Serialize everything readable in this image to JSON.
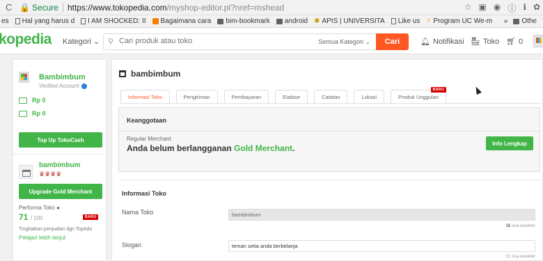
{
  "browser": {
    "secure_label": "Secure",
    "url_host": "https://www.tokopedia.com",
    "url_path": "/myshop-editor.pl?nref=mshead",
    "bookmarks": [
      {
        "label": "es",
        "icon": "app"
      },
      {
        "label": "Hal yang harus d",
        "icon": "doc"
      },
      {
        "label": "I AM SHOCKED: II",
        "icon": "doc"
      },
      {
        "label": "Bagaimana cara",
        "icon": "blog"
      },
      {
        "label": "bim-bookmark",
        "icon": "folder"
      },
      {
        "label": "android",
        "icon": "folder"
      },
      {
        "label": "APIS | UNIVERSITA",
        "icon": "gear"
      },
      {
        "label": "Like us",
        "icon": "doc"
      },
      {
        "label": "Program UC We-m",
        "icon": "star"
      }
    ],
    "bookmarks_more": "»",
    "bookmarks_other": "Othe"
  },
  "header": {
    "logo": "kopedia",
    "kategori": "Kategori",
    "search_placeholder": "Cari produk atau toko",
    "search_category": "Semua Kategori",
    "cari": "Cari",
    "notifikasi": "Notifikasi",
    "toko": "Toko",
    "cart_count": "0"
  },
  "sidebar": {
    "name": "Bambimbum",
    "verified": "Verified Account",
    "saldo_1": "Rp 0",
    "saldo_2": "Rp 0",
    "topup": "Top Up TokoCash",
    "shop_name": "bambimbum",
    "medals": "♛♛♛♛",
    "upgrade": "Upgrade Gold Merchant",
    "performa_label": "Performa Toko",
    "performa_value": "71",
    "performa_max": "/ 100",
    "baru": "BARU",
    "tingkatkan": "Tingkatkan penjualan dgn TopAds",
    "pelajari": "Pelajari lebih lanjut"
  },
  "main": {
    "shop_title": "bambimbum",
    "tabs": [
      {
        "label": "Informasi Toko"
      },
      {
        "label": "Pengiriman"
      },
      {
        "label": "Pembayaran"
      },
      {
        "label": "Etalase"
      },
      {
        "label": "Catatan"
      },
      {
        "label": "Lokasi"
      },
      {
        "label": "Produk Unggulan"
      }
    ],
    "tab_badge": "BARU",
    "keanggotaan": "Keanggotaan",
    "regular_merchant": "Regular Merchant",
    "belum_prefix": "Anda belum berlangganan ",
    "gold_merchant": "Gold Merchant",
    "belum_suffix": ".",
    "info_lengkap": "Info Lengkap",
    "informasi_toko": "Informasi Toko",
    "nama_label": "Nama Toko",
    "nama_value": "bambimbum",
    "nama_sisa_num": "15",
    "nama_sisa_text": " sisa karakter",
    "slogan_label": "Slogan",
    "slogan_value": "teman setia anda berbelanja",
    "slogan_sisa": "21 sisa karakter"
  },
  "colors": {
    "brand_green": "#42b549",
    "cta_orange": "#ff5722",
    "badge_red": "#d50000"
  }
}
